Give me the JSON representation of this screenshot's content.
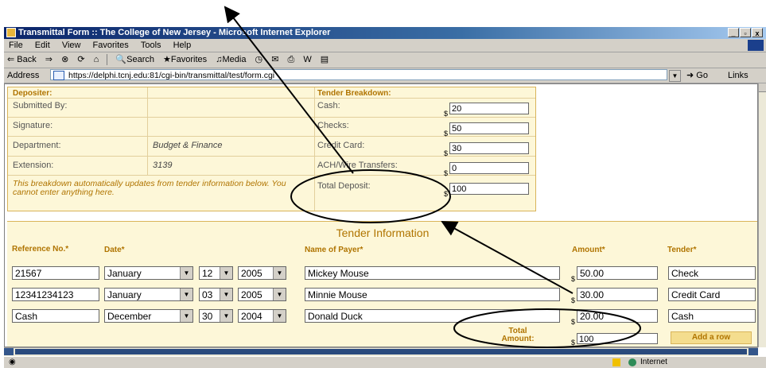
{
  "window": {
    "title": "Transmittal Form :: The College of New Jersey - Microsoft Internet Explorer",
    "min": "_",
    "max": "▫",
    "close": "x"
  },
  "menu": [
    "File",
    "Edit",
    "View",
    "Favorites",
    "Tools",
    "Help"
  ],
  "toolbar": {
    "back": "⇐ Back",
    "forward": "⇒",
    "search": "Search",
    "favorites": "Favorites",
    "media": "Media"
  },
  "address": {
    "label": "Address",
    "url": "https://delphi.tcnj.edu:81/cgi-bin/transmittal/test/form.cgi",
    "go": "Go",
    "links": "Links"
  },
  "depositer": {
    "heading": "Depositer:",
    "rows": [
      {
        "label": "Submitted By:",
        "value": ""
      },
      {
        "label": "Signature:",
        "value": ""
      },
      {
        "label": "Department:",
        "value": "Budget & Finance"
      },
      {
        "label": "Extension:",
        "value": "3139"
      }
    ],
    "note": "This breakdown automatically updates from tender information below. You cannot enter anything here."
  },
  "breakdown": {
    "heading": "Tender Breakdown:",
    "currency": "$",
    "rows": [
      {
        "label": "Cash:",
        "value": "20"
      },
      {
        "label": "Checks:",
        "value": "50"
      },
      {
        "label": "Credit Card:",
        "value": "30"
      },
      {
        "label": "ACH/Wire Transfers:",
        "value": "0"
      },
      {
        "label": "Total Deposit:",
        "value": "100"
      }
    ]
  },
  "tender": {
    "title": "Tender Information",
    "headers": {
      "reference": "Reference No.*",
      "date": "Date*",
      "payer": "Name of Payer*",
      "amount": "Amount*",
      "tender": "Tender*"
    },
    "rows": [
      {
        "reference": "21567",
        "month": "January",
        "day": "12",
        "year": "2005",
        "payer": "Mickey Mouse",
        "amount": "50.00",
        "tender": "Check"
      },
      {
        "reference": "12341234123",
        "month": "January",
        "day": "03",
        "year": "2005",
        "payer": "Minnie Mouse",
        "amount": "30.00",
        "tender": "Credit Card"
      },
      {
        "reference": "Cash",
        "month": "December",
        "day": "30",
        "year": "2004",
        "payer": "Donald Duck",
        "amount": "20.00",
        "tender": "Cash"
      }
    ],
    "total_label": "Total Amount:",
    "total_value": "100",
    "add_row": "Add a row"
  },
  "status": {
    "zone": "Internet"
  }
}
